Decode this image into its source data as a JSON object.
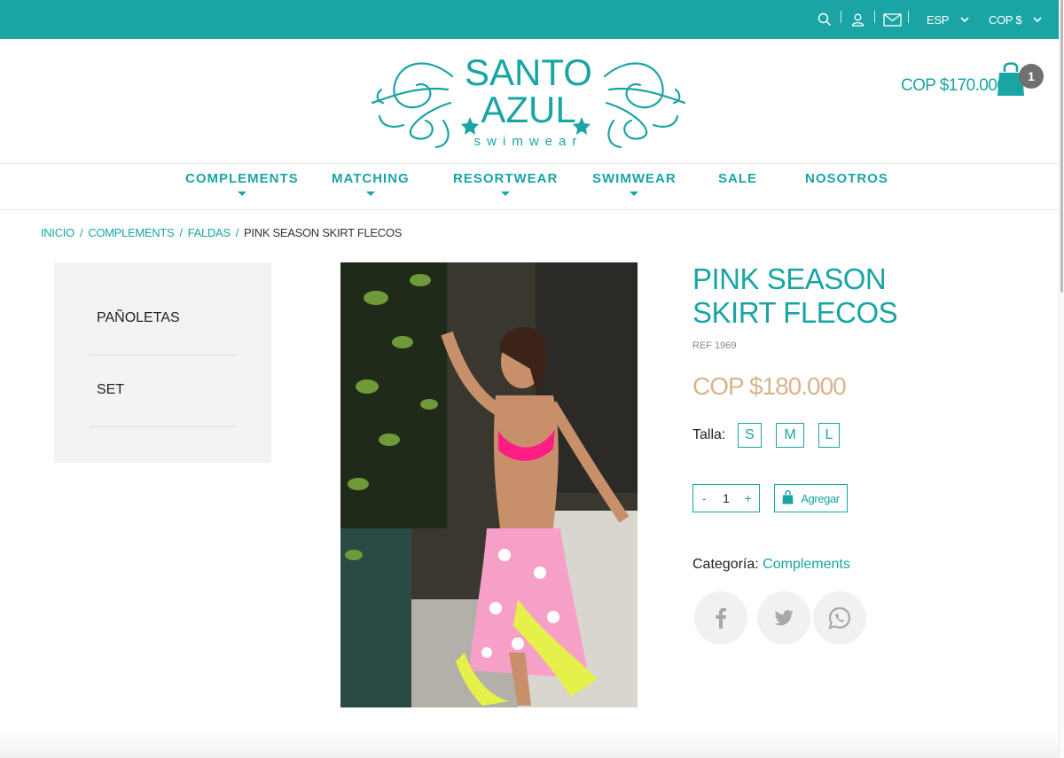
{
  "topbar": {
    "bg_color": "#1aa4a4",
    "icons": [
      "search-icon",
      "user-icon",
      "mail-icon"
    ],
    "language": "ESP",
    "currency": "COP $"
  },
  "header": {
    "logo_text": "SANTO AZUL",
    "logo_subtext": "swimwear",
    "cart_total": "COP $170.000",
    "cart_count": "1"
  },
  "nav": {
    "items": [
      {
        "label": "COMPLEMENTS",
        "has_dropdown": true
      },
      {
        "label": "MATCHING",
        "has_dropdown": true
      },
      {
        "label": "RESORTWEAR",
        "has_dropdown": true
      },
      {
        "label": "SWIMWEAR",
        "has_dropdown": true
      },
      {
        "label": "SALE",
        "has_dropdown": false
      },
      {
        "label": "NOSOTROS",
        "has_dropdown": false
      }
    ]
  },
  "breadcrumb": {
    "items": [
      "INICIO",
      "COMPLEMENTS",
      "FALDAS"
    ],
    "separator": "/",
    "current": "PINK SEASON SKIRT FLECOS"
  },
  "sidebar": {
    "items": [
      "PAÑOLETAS",
      "SET"
    ]
  },
  "product": {
    "title_line1": "PINK SEASON",
    "title_line2": "SKIRT FLECOS",
    "ref": "REF 1969",
    "price": "COP $180.000",
    "size_label": "Talla:",
    "sizes": [
      "S",
      "M",
      "L"
    ],
    "qty_minus": "-",
    "qty_value": "1",
    "qty_plus": "+",
    "add_label": "Agregar",
    "category_label": "Categoría:",
    "category_value": "Complements",
    "share_icons": [
      "facebook-icon",
      "twitter-icon",
      "whatsapp-icon"
    ]
  },
  "colors": {
    "accent": "#1aa4a4",
    "price": "#d9b38c",
    "badge": "#6f6f6f"
  }
}
